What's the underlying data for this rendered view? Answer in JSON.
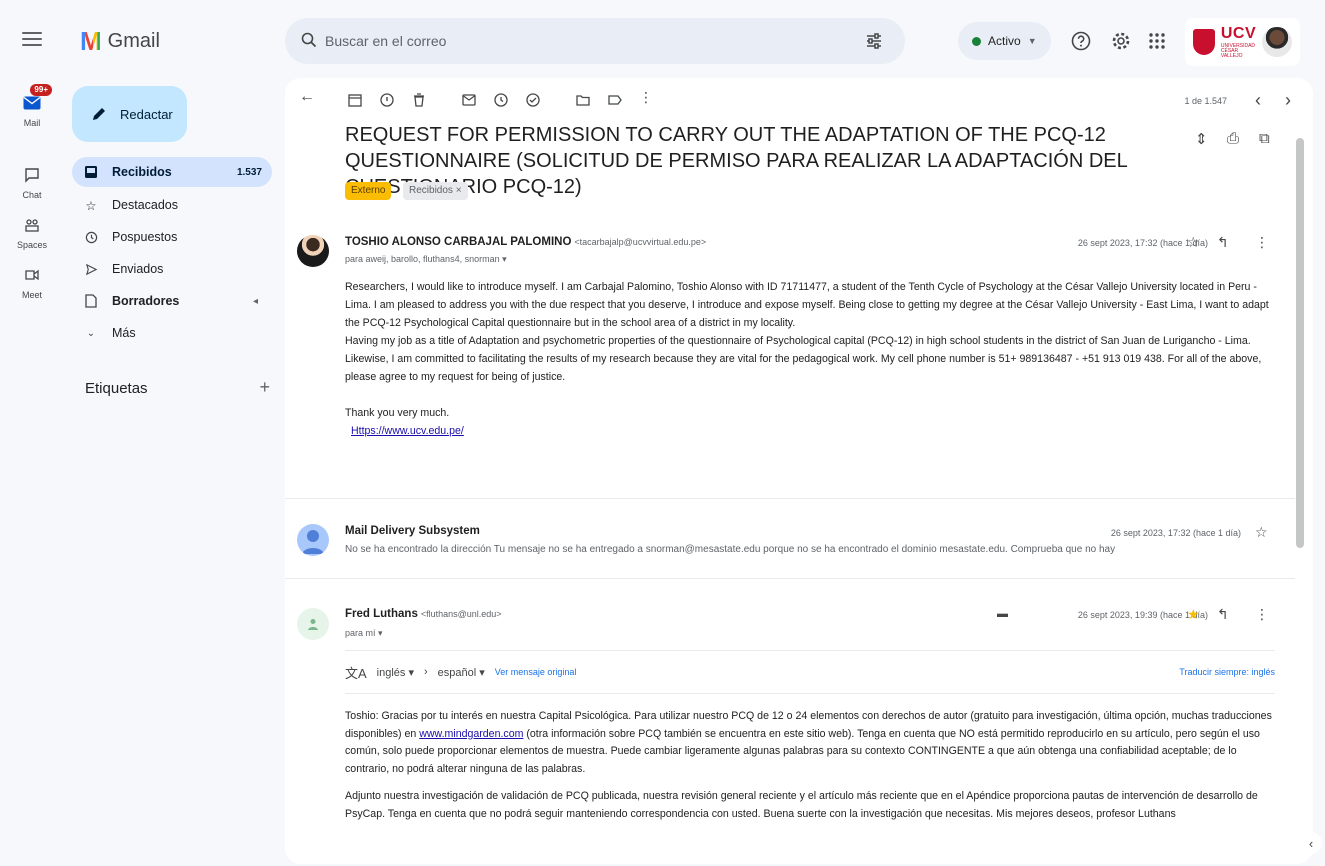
{
  "app": {
    "name": "Gmail"
  },
  "search": {
    "placeholder": "Buscar en el correo"
  },
  "status": {
    "label": "Activo"
  },
  "brand": {
    "name": "UCV",
    "subtitle": "UNIVERSIDAD CÉSAR VALLEJO"
  },
  "rail": {
    "mail": {
      "label": "Mail",
      "badge": "99+"
    },
    "chat": {
      "label": "Chat"
    },
    "spaces": {
      "label": "Spaces"
    },
    "meet": {
      "label": "Meet"
    }
  },
  "compose": {
    "label": "Redactar"
  },
  "nav": [
    {
      "label": "Recibidos",
      "count": "1.537",
      "icon": "inbox-icon"
    },
    {
      "label": "Destacados",
      "icon": "star-icon"
    },
    {
      "label": "Pospuestos",
      "icon": "clock-icon"
    },
    {
      "label": "Enviados",
      "icon": "send-icon"
    },
    {
      "label": "Borradores",
      "icon": "draft-icon"
    },
    {
      "label": "Más",
      "icon": "chevron-down-icon"
    }
  ],
  "labels": {
    "heading": "Etiquetas"
  },
  "toolbar": {
    "pager": "1 de 1.547"
  },
  "thread": {
    "subject": "REQUEST FOR PERMISSION TO CARRY OUT THE ADAPTATION OF THE PCQ-12 QUESTIONNAIRE (SOLICITUD DE PERMISO PARA REALIZAR LA ADAPTACIÓN DEL CUESTIONARIO PCQ-12)",
    "chips": {
      "external": "Externo",
      "inbox": "Recibidos ×"
    }
  },
  "messages": [
    {
      "sender": "TOSHIO ALONSO CARBAJAL PALOMINO",
      "address": "<tacarbajalp@ucvvirtual.edu.pe>",
      "recipients": "para aweij, barollo, fluthans4, snorman ▾",
      "date": "26 sept 2023, 17:32 (hace 1 día)",
      "body": [
        "Researchers, I would like to introduce myself. I am Carbajal Palomino, Toshio Alonso with ID 71711477, a student of the Tenth Cycle of Psychology at the César Vallejo University located in Peru - Lima. I am pleased to address you with the due respect that you deserve, I introduce and expose myself. Being close to getting my degree at the César Vallejo University - East Lima, I want to adapt the PCQ-12 Psychological Capital questionnaire but in the school area of a district in my locality.",
        "Having my job as a title of Adaptation and psychometric properties of the questionnaire of Psychological capital (PCQ-12) in high school students in the district of San Juan de Lurigancho - Lima.",
        "Likewise, I am committed to facilitating the results of my research because they are vital for the pedagogical work. My cell phone number is 51+ 989136487 - +51 913 019 438. For all of the above, please agree to my request for being of justice."
      ],
      "closing": "Thank you very much.",
      "link": "Https://www.ucv.edu.pe/"
    },
    {
      "sender": "Mail Delivery Subsystem",
      "date": "26 sept 2023, 17:32 (hace 1 día)",
      "snippet": "No se ha encontrado la dirección Tu mensaje no se ha entregado a snorman@mesastate.edu porque no se ha encontrado el dominio mesastate.edu. Comprueba que no hay"
    },
    {
      "sender": "Fred Luthans",
      "address": "<fluthans@unl.edu>",
      "recipients": "para mí ▾",
      "date": "26 sept 2023, 19:39 (hace 1 día)",
      "translate": {
        "from": "inglés ▾",
        "arrow": "›",
        "to": "español ▾",
        "view_original": "Ver mensaje original",
        "always": "Traducir siempre: inglés"
      },
      "body1_pre": "Toshio: Gracias por tu interés en nuestra Capital Psicológica. Para utilizar nuestro PCQ de 12 o 24 elementos con derechos de autor (gratuito para investigación, última opción, muchas traducciones disponibles) en ",
      "body1_link": "www.mindgarden.com",
      "body1_post": " (otra información sobre PCQ también se encuentra en este sitio web). Tenga en cuenta que NO está permitido reproducirlo en su artículo, pero según el uso común, solo puede proporcionar elementos de muestra. Puede cambiar ligeramente algunas palabras para su contexto CONTINGENTE a que aún obtenga una confiabilidad aceptable; de lo contrario, no podrá alterar ninguna de las palabras.",
      "body2": "Adjunto nuestra investigación de validación de PCQ publicada, nuestra revisión general reciente y el artículo más reciente que en el Apéndice proporciona pautas de intervención de desarrollo de PsyCap. Tenga en cuenta que no podrá seguir manteniendo correspondencia con usted. Buena suerte con la investigación que necesitas. Mis mejores deseos, profesor Luthans"
    }
  ],
  "colors": {
    "accent": "#c2e7ff",
    "active_nav": "#d3e3fd",
    "badge": "#c5221f",
    "external_chip": "#fbbc04",
    "star_filled": "#fbbc04",
    "status_online": "#188038",
    "brand": "#c8102e"
  }
}
